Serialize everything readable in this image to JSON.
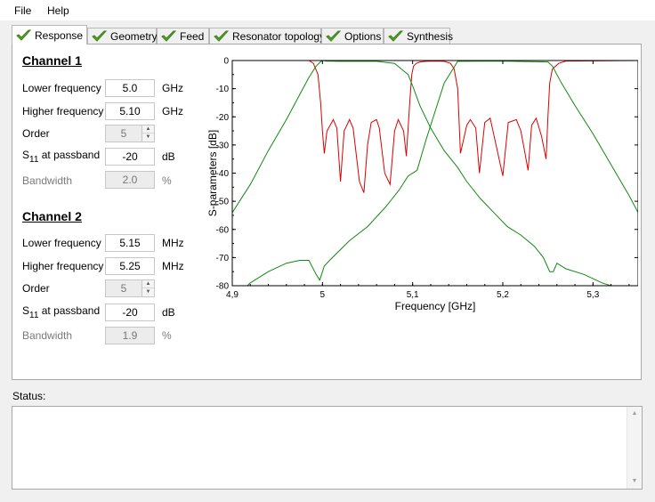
{
  "menu": {
    "items": [
      "File",
      "Help"
    ]
  },
  "tabs": [
    {
      "label": "Response",
      "active": true
    },
    {
      "label": "Geometry"
    },
    {
      "label": "Feed"
    },
    {
      "label": "Resonator topology"
    },
    {
      "label": "Options"
    },
    {
      "label": "Synthesis"
    }
  ],
  "channel1": {
    "heading": "Channel 1",
    "lower_label": "Lower frequency",
    "lower_value": "5.0",
    "lower_unit": "GHz",
    "higher_label": "Higher frequency",
    "higher_value": "5.10",
    "higher_unit": "GHz",
    "order_label": "Order",
    "order_value": "5",
    "s11_prefix": "S",
    "s11_sub": "11",
    "s11_suffix": " at passband",
    "s11_value": "-20",
    "s11_unit": "dB",
    "bandwidth_label": "Bandwidth",
    "bandwidth_value": "2.0",
    "bandwidth_unit": "%"
  },
  "channel2": {
    "heading": "Channel 2",
    "lower_label": "Lower frequency",
    "lower_value": "5.15",
    "lower_unit": "MHz",
    "higher_label": "Higher frequency",
    "higher_value": "5.25",
    "higher_unit": "MHz",
    "order_label": "Order",
    "order_value": "5",
    "s11_prefix": "S",
    "s11_sub": "11",
    "s11_suffix": " at passband",
    "s11_value": "-20",
    "s11_unit": "dB",
    "bandwidth_label": "Bandwidth",
    "bandwidth_value": "1.9",
    "bandwidth_unit": "%"
  },
  "status": {
    "label": "Status:",
    "text": ""
  },
  "chart_data": {
    "type": "line",
    "xlabel": "Frequency [GHz]",
    "ylabel": "S-parameters [dB]",
    "xlim": [
      4.9,
      5.35
    ],
    "ylim": [
      -80,
      0
    ],
    "xticks": [
      4.9,
      5.0,
      5.1,
      5.2,
      5.3
    ],
    "xtick_labels": [
      "4,9",
      "5",
      "5,1",
      "5,2",
      "5,3"
    ],
    "yticks": [
      0,
      -10,
      -20,
      -30,
      -40,
      -50,
      -60,
      -70,
      -80
    ],
    "ytick_labels": [
      "0",
      "-10",
      "-20",
      "-30",
      "-40",
      "-50",
      "-60",
      "-70",
      "-80"
    ],
    "grid": false,
    "legend": "none",
    "series": [
      {
        "color": "#dd0000",
        "x": [
          4.9,
          4.985,
          4.99,
          4.995,
          4.998,
          5.0,
          5.002,
          5.005,
          5.012,
          5.016,
          5.02,
          5.024,
          5.03,
          5.034,
          5.041,
          5.046,
          5.05,
          5.054,
          5.06,
          5.063,
          5.069,
          5.075,
          5.08,
          5.084,
          5.09,
          5.093,
          5.097,
          5.099,
          5.101,
          5.104,
          5.108,
          5.115,
          5.125,
          5.135,
          5.142,
          5.146,
          5.15,
          5.153,
          5.16,
          5.164,
          5.17,
          5.174,
          5.18,
          5.186,
          5.2,
          5.206,
          5.215,
          5.22,
          5.228,
          5.232,
          5.237,
          5.243,
          5.248,
          5.25,
          5.252,
          5.255,
          5.262,
          5.27,
          5.35
        ],
        "y": [
          0,
          0,
          -1,
          -5,
          -15,
          -25,
          -33,
          -25,
          -21,
          -24,
          -43,
          -25,
          -21,
          -24,
          -43,
          -47,
          -30,
          -22,
          -21,
          -24,
          -40,
          -44,
          -25,
          -21,
          -25,
          -34,
          -14,
          -5,
          -2,
          -1,
          -0.5,
          -0.3,
          -0.2,
          -0.3,
          -1,
          -3,
          -10,
          -33,
          -23,
          -21,
          -24,
          -40,
          -22,
          -20.5,
          -41,
          -22,
          -21,
          -25,
          -39,
          -23,
          -20.5,
          -27,
          -35,
          -20,
          -8,
          -3,
          -1,
          -0.2,
          0
        ]
      },
      {
        "color": "#118811",
        "x": [
          4.9,
          4.92,
          4.94,
          4.96,
          4.975,
          4.985,
          4.993,
          4.998,
          5.0,
          5.005,
          5.02,
          5.04,
          5.06,
          5.08,
          5.095,
          5.1,
          5.108,
          5.12,
          5.135,
          5.15,
          5.16,
          5.175,
          5.19,
          5.205,
          5.22,
          5.235,
          5.245,
          5.252,
          5.256,
          5.26,
          5.27,
          5.29,
          5.31,
          5.33,
          5.35
        ],
        "y": [
          -54,
          -44,
          -32,
          -21,
          -12,
          -6,
          -2,
          -0.4,
          0,
          -0.2,
          -0.3,
          -0.3,
          -0.3,
          -1,
          -5,
          -9,
          -16,
          -24,
          -32,
          -38,
          -43,
          -49,
          -54,
          -59,
          -62,
          -66,
          -70,
          -75,
          -75,
          -72,
          -74,
          -76,
          -79,
          -81,
          -83
        ]
      },
      {
        "color": "#118811",
        "x": [
          4.9,
          4.92,
          4.94,
          4.96,
          4.975,
          4.985,
          4.993,
          4.997,
          5.002,
          5.008,
          5.03,
          5.05,
          5.07,
          5.085,
          5.095,
          5.105,
          5.115,
          5.125,
          5.135,
          5.15,
          5.2,
          5.25,
          5.255,
          5.265,
          5.28,
          5.3,
          5.32,
          5.34,
          5.35
        ],
        "y": [
          -85,
          -79,
          -75,
          -72,
          -71,
          -71,
          -76,
          -78,
          -73,
          -71,
          -64,
          -59,
          -52,
          -46,
          -41,
          -39,
          -28,
          -18,
          -8,
          -0.3,
          -0.2,
          -0.5,
          -2,
          -8,
          -16,
          -26,
          -37,
          -48,
          -54
        ]
      }
    ]
  }
}
